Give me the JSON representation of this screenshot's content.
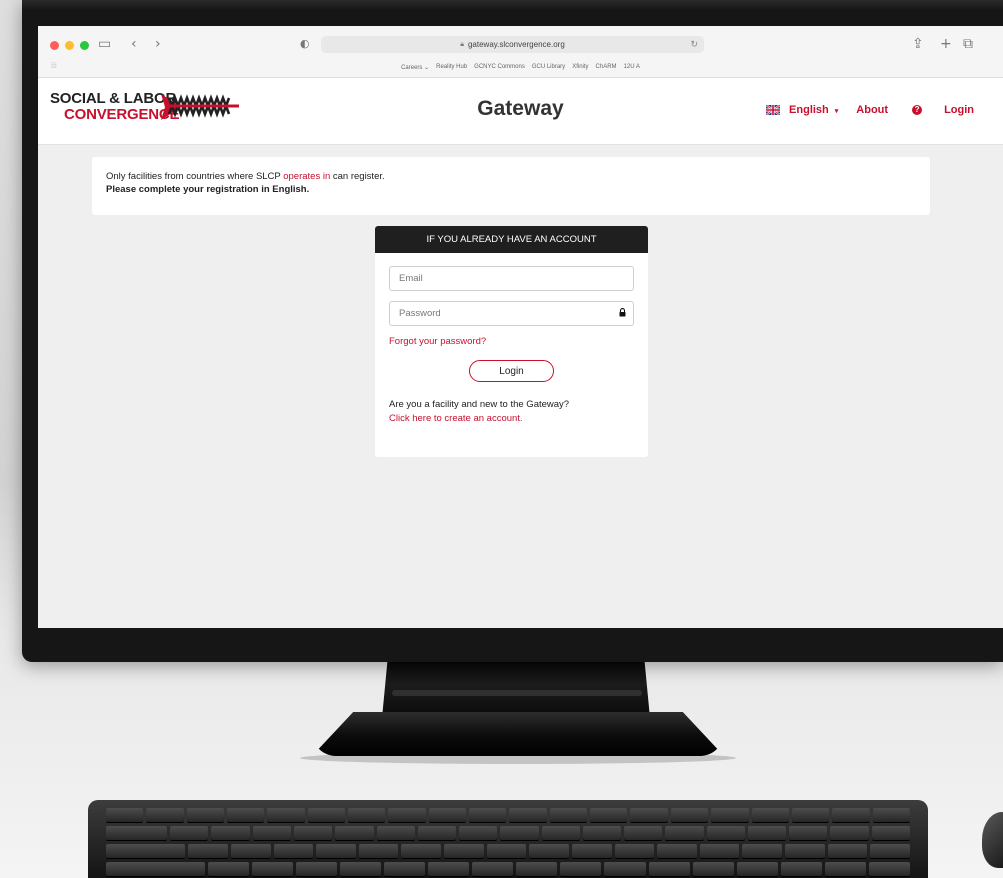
{
  "browser": {
    "url": "gateway.slconvergence.org",
    "bookmarks": [
      "Careers ⌄",
      "Reality Hub",
      "GCNYC Commons",
      "GCU Library",
      "Xfinity",
      "ChARM",
      "12U A"
    ]
  },
  "header": {
    "logo_line1": "SOCIAL & LABOR",
    "logo_line2": "CONVERGENCE",
    "title": "Gateway",
    "nav": {
      "language": "English",
      "about": "About",
      "login": "Login"
    }
  },
  "notice": {
    "line1_before": "Only facilities from countries where SLCP ",
    "line1_link": "operates in",
    "line1_after": " can register.",
    "line2": "Please complete your registration in English."
  },
  "login_card": {
    "heading": "IF YOU ALREADY HAVE AN ACCOUNT",
    "email_placeholder": "Email",
    "password_placeholder": "Password",
    "forgot_label": "Forgot your password?",
    "login_button": "Login",
    "new_prompt": "Are you a facility and new to the Gateway?",
    "create_link": "Click here to create an account."
  },
  "colors": {
    "brand_red": "#c8102e",
    "card_header": "#1f1f1f",
    "page_bg": "#efefef"
  },
  "icons": [
    "sidebar-toggle-icon",
    "back-arrow-icon",
    "forward-arrow-icon",
    "shield-icon",
    "reload-icon",
    "share-icon",
    "new-tab-icon",
    "tabs-overview-icon",
    "uk-flag-icon",
    "help-icon",
    "lock-icon"
  ]
}
